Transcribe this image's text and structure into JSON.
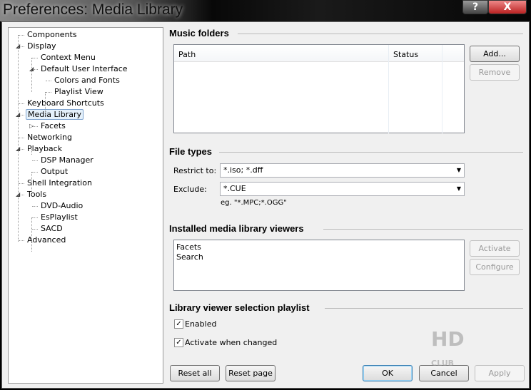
{
  "window": {
    "title": "Preferences: Media Library",
    "help": "?",
    "close": "X"
  },
  "tree": [
    {
      "label": "Components",
      "level": 0,
      "exp": ""
    },
    {
      "label": "Display",
      "level": 0,
      "exp": "◢"
    },
    {
      "label": "Context Menu",
      "level": 1,
      "exp": ""
    },
    {
      "label": "Default User Interface",
      "level": 1,
      "exp": "◢"
    },
    {
      "label": "Colors and Fonts",
      "level": 2,
      "exp": ""
    },
    {
      "label": "Playlist View",
      "level": 2,
      "exp": ""
    },
    {
      "label": "Keyboard Shortcuts",
      "level": 0,
      "exp": ""
    },
    {
      "label": "Media Library",
      "level": 0,
      "exp": "◢",
      "selected": true
    },
    {
      "label": "Facets",
      "level": 1,
      "exp": "▷"
    },
    {
      "label": "Networking",
      "level": 0,
      "exp": ""
    },
    {
      "label": "Playback",
      "level": 0,
      "exp": "◢"
    },
    {
      "label": "DSP Manager",
      "level": 1,
      "exp": ""
    },
    {
      "label": "Output",
      "level": 1,
      "exp": ""
    },
    {
      "label": "Shell Integration",
      "level": 0,
      "exp": ""
    },
    {
      "label": "Tools",
      "level": 0,
      "exp": "◢"
    },
    {
      "label": "DVD-Audio",
      "level": 1,
      "exp": ""
    },
    {
      "label": "EsPlaylist",
      "level": 1,
      "exp": ""
    },
    {
      "label": "SACD",
      "level": 1,
      "exp": ""
    },
    {
      "label": "Advanced",
      "level": 0,
      "exp": ""
    }
  ],
  "music_folders": {
    "title": "Music folders",
    "col_path": "Path",
    "col_status": "Status",
    "add": "Add...",
    "remove": "Remove"
  },
  "file_types": {
    "title": "File types",
    "restrict_label": "Restrict to:",
    "restrict_value": "*.iso; *.dff",
    "exclude_label": "Exclude:",
    "exclude_value": "*.CUE",
    "hint": "eg. \"*.MPC;*.OGG\""
  },
  "viewers": {
    "title": "Installed media library viewers",
    "items": [
      "Facets",
      "Search"
    ],
    "activate": "Activate",
    "configure": "Configure"
  },
  "playlist": {
    "title": "Library viewer selection playlist",
    "enabled": "Enabled",
    "enabled_checked": true,
    "activate_changed": "Activate when changed",
    "activate_checked": true
  },
  "footer": {
    "reset_all": "Reset all",
    "reset_page": "Reset page",
    "ok": "OK",
    "cancel": "Cancel",
    "apply": "Apply"
  },
  "watermark": {
    "text": "HD CLUB",
    "url": "HD.club.tw"
  }
}
